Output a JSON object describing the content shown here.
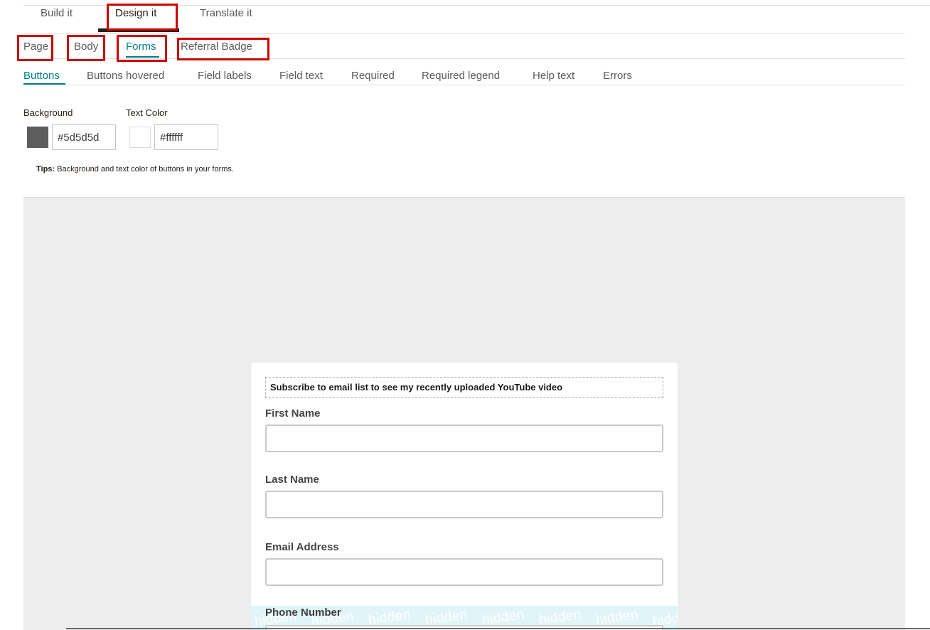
{
  "top_tabs": [
    {
      "label": "Build it"
    },
    {
      "label": "Design it"
    },
    {
      "label": "Translate it"
    }
  ],
  "sub_tabs": [
    {
      "label": "Page"
    },
    {
      "label": "Body"
    },
    {
      "label": "Forms"
    },
    {
      "label": "Referral Badge"
    }
  ],
  "third_tabs": [
    {
      "label": "Buttons"
    },
    {
      "label": "Buttons hovered"
    },
    {
      "label": "Field labels"
    },
    {
      "label": "Field text"
    },
    {
      "label": "Required"
    },
    {
      "label": "Required legend"
    },
    {
      "label": "Help text"
    },
    {
      "label": "Errors"
    }
  ],
  "controls": {
    "background": {
      "label": "Background",
      "value": "#5d5d5d",
      "swatch_color": "#5d5d5d"
    },
    "text_color": {
      "label": "Text Color",
      "value": "#ffffff",
      "swatch_color": "#ffffff"
    }
  },
  "tips": {
    "prefix": "Tips:",
    "text": " Background and text color of buttons in your forms."
  },
  "preview": {
    "heading": "Subscribe to email list to see my recently uploaded YouTube video",
    "fields": [
      {
        "label": "First Name",
        "value": ""
      },
      {
        "label": "Last Name",
        "value": ""
      },
      {
        "label": "Email Address",
        "value": ""
      },
      {
        "label": "Phone Number",
        "value": ""
      }
    ],
    "hidden_watermark": "hidden"
  },
  "colors": {
    "accent": "#007c89",
    "active_tab": "#241c15",
    "highlight_box": "#cc0000",
    "preview_bg": "#ededed",
    "hidden_band": "#e1f5f9"
  }
}
